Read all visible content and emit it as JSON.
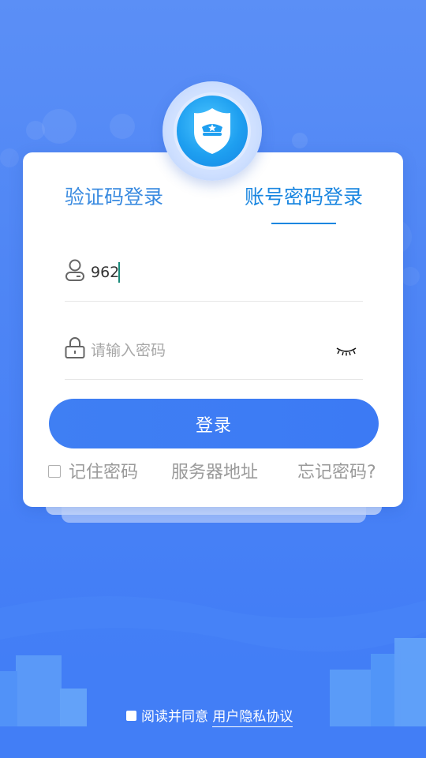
{
  "tabs": {
    "sms_login": "验证码登录",
    "account_login": "账号密码登录"
  },
  "username": {
    "icon": "user-icon",
    "value": "962"
  },
  "password": {
    "icon": "lock-icon",
    "placeholder": "请输入密码",
    "toggle_icon": "eye-closed-icon"
  },
  "login_button": "登录",
  "options": {
    "remember": "记住密码",
    "server": "服务器地址",
    "forgot": "忘记密码?"
  },
  "agreement": {
    "prefix": "阅读并同意",
    "link": "用户隐私协议"
  },
  "badge": {
    "icon": "police-shield-icon"
  },
  "colors": {
    "accent": "#1a86e0",
    "button": "#3f7ff3",
    "background": "#4f86f5"
  }
}
